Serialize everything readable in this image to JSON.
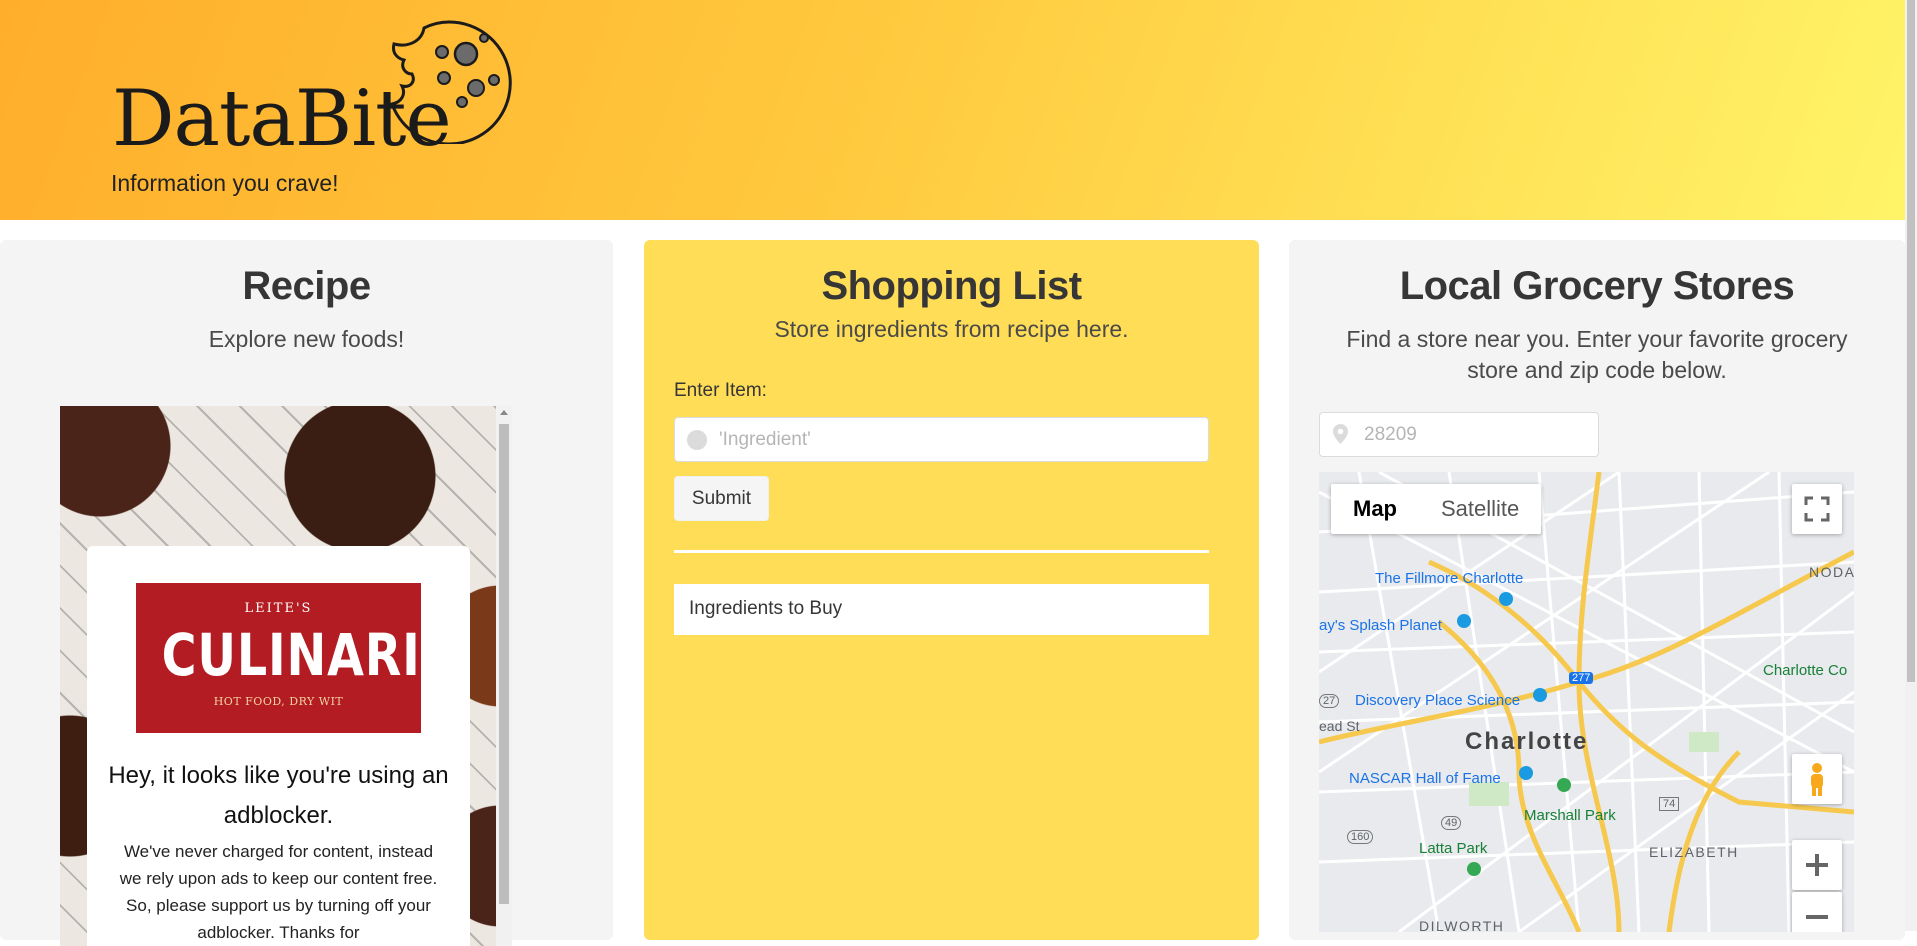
{
  "header": {
    "logo_text": "DataBite",
    "tagline": "Information you crave!"
  },
  "recipe": {
    "title": "Recipe",
    "subtitle": "Explore new foods!",
    "ad": {
      "brand_small": "LEITE'S",
      "brand_big": "CULINARIA",
      "brand_tag": "HOT FOOD, DRY WIT",
      "heading": "Hey, it looks like you're using an adblocker.",
      "body": "We've never charged for content, instead we rely upon ads to keep our content free. So, please support us by turning off your adblocker. Thanks for"
    }
  },
  "shopping": {
    "title": "Shopping List",
    "subtitle": "Store ingredients from recipe here.",
    "input_label": "Enter Item:",
    "input_placeholder": "'Ingredient'",
    "submit_label": "Submit",
    "list_header": "Ingredients to Buy"
  },
  "grocery": {
    "title": "Local Grocery Stores",
    "subtitle": "Find a store near you. Enter your favorite grocery store and zip code below.",
    "zip_placeholder": "28209",
    "map": {
      "type_map": "Map",
      "type_satellite": "Satellite",
      "city": "Charlotte",
      "labels": {
        "fillmore": "The Fillmore Charlotte",
        "splash": "ay's Splash Planet",
        "discovery": "Discovery Place Science",
        "nascar": "NASCAR Hall of Fame",
        "marshall": "Marshall Park",
        "latta": "Latta Park",
        "elizabeth": "ELIZABETH",
        "dilworth": "DILWORTH",
        "noda": "NODA",
        "charlotte_co": "Charlotte Co",
        "lead_st": "ead St",
        "rt277": "277",
        "rt74": "74",
        "rt49": "49",
        "rt160": "160",
        "rt27": "27"
      }
    }
  },
  "colors": {
    "hero_start": "#ffae2b",
    "hero_end": "#fff468",
    "shopping_bg": "#ffdd57",
    "panel_bg": "#f4f4f4",
    "brand_red": "#b31c22"
  }
}
